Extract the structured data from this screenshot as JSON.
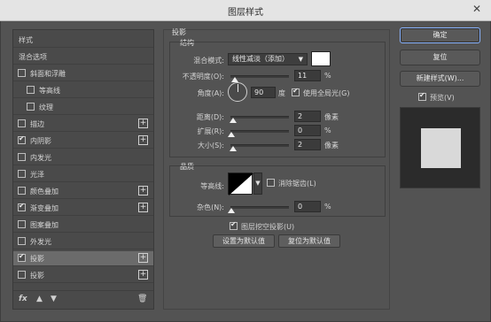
{
  "window": {
    "title": "图层样式",
    "close": "✕"
  },
  "style_list": {
    "items": [
      {
        "label": "样式",
        "checkbox": false,
        "checked": false,
        "plus": false,
        "indent": 0
      },
      {
        "label": "混合选项",
        "checkbox": false,
        "checked": false,
        "plus": false,
        "indent": 0
      },
      {
        "label": "斜面和浮雕",
        "checkbox": true,
        "checked": false,
        "plus": false,
        "indent": 0
      },
      {
        "label": "等高线",
        "checkbox": true,
        "checked": false,
        "plus": false,
        "indent": 1
      },
      {
        "label": "纹理",
        "checkbox": true,
        "checked": false,
        "plus": false,
        "indent": 1
      },
      {
        "label": "描边",
        "checkbox": true,
        "checked": false,
        "plus": true,
        "indent": 0
      },
      {
        "label": "内阴影",
        "checkbox": true,
        "checked": true,
        "plus": true,
        "indent": 0
      },
      {
        "label": "内发光",
        "checkbox": true,
        "checked": false,
        "plus": false,
        "indent": 0
      },
      {
        "label": "光泽",
        "checkbox": true,
        "checked": false,
        "plus": false,
        "indent": 0
      },
      {
        "label": "颜色叠加",
        "checkbox": true,
        "checked": false,
        "plus": true,
        "indent": 0
      },
      {
        "label": "渐变叠加",
        "checkbox": true,
        "checked": true,
        "plus": true,
        "indent": 0
      },
      {
        "label": "图案叠加",
        "checkbox": true,
        "checked": false,
        "plus": false,
        "indent": 0
      },
      {
        "label": "外发光",
        "checkbox": true,
        "checked": false,
        "plus": false,
        "indent": 0
      },
      {
        "label": "投影",
        "checkbox": true,
        "checked": true,
        "plus": true,
        "indent": 0,
        "active": true
      },
      {
        "label": "投影",
        "checkbox": true,
        "checked": false,
        "plus": true,
        "indent": 0
      }
    ],
    "bottom_icons": [
      "fx",
      "▲",
      "▼",
      "🗑"
    ]
  },
  "shadow": {
    "section_title": "投影",
    "structure_title": "结构",
    "blend_mode_label": "混合模式:",
    "blend_mode_value": "线性减淡（添加）",
    "opacity_label": "不透明度(O):",
    "opacity_value": "11",
    "opacity_unit": "%",
    "angle_label": "角度(A):",
    "angle_value": "90",
    "angle_unit": "度",
    "global_light_label": "使用全局光(G)",
    "global_light_checked": true,
    "distance_label": "距离(D):",
    "distance_value": "2",
    "distance_unit": "像素",
    "spread_label": "扩展(R):",
    "spread_value": "0",
    "spread_unit": "%",
    "size_label": "大小(S):",
    "size_value": "2",
    "size_unit": "像素",
    "quality_title": "品质",
    "contour_label": "等高线:",
    "antialias_label": "消除锯齿(L)",
    "noise_label": "杂色(N):",
    "noise_value": "0",
    "noise_unit": "%",
    "knockout_label": "图层挖空投影(U)",
    "knockout_checked": true,
    "set_default_label": "设置为默认值",
    "reset_default_label": "复位为默认值",
    "swatch_color": "#ffffff"
  },
  "buttons": {
    "ok": "确定",
    "reset": "复位",
    "new_style": "新建样式(W)...",
    "preview_label": "预览(V)",
    "preview_checked": true
  }
}
